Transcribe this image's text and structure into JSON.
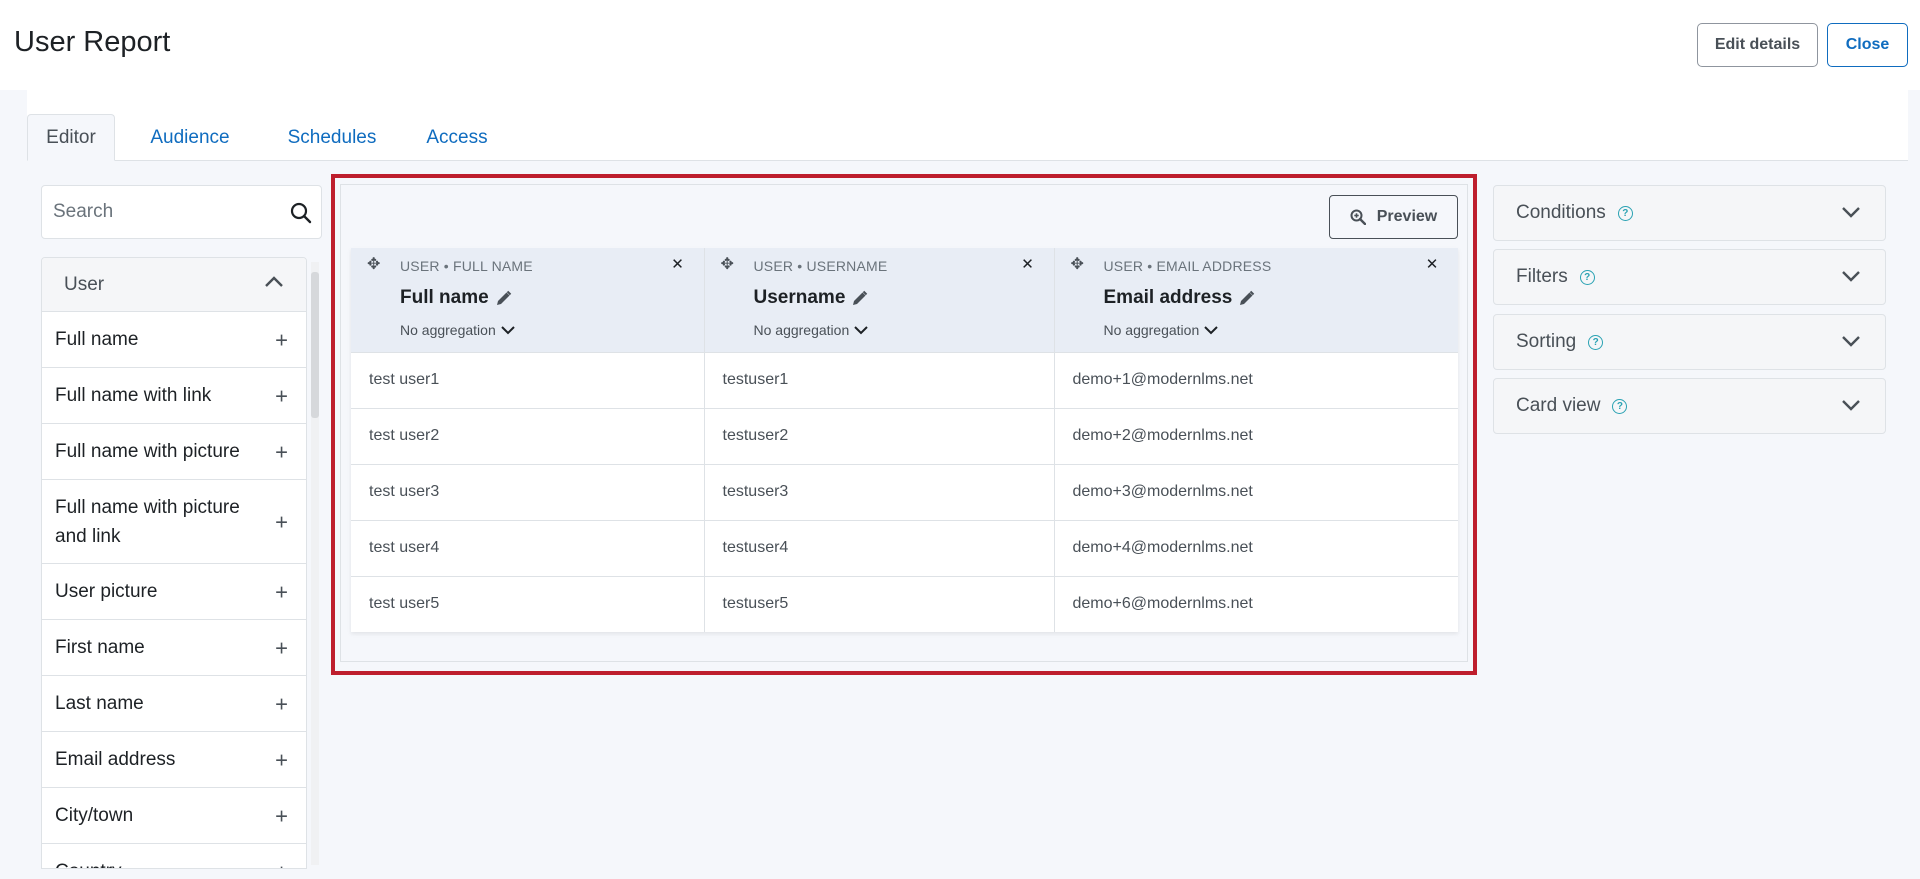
{
  "header": {
    "title": "User Report",
    "edit_label": "Edit details",
    "close_label": "Close"
  },
  "tabs": [
    {
      "label": "Editor",
      "active": true
    },
    {
      "label": "Audience"
    },
    {
      "label": "Schedules"
    },
    {
      "label": "Access"
    }
  ],
  "search": {
    "placeholder": "Search"
  },
  "sidebar": {
    "group": "User",
    "items": [
      "Full name",
      "Full name with link",
      "Full name with picture",
      "Full name with picture and link",
      "User picture",
      "First name",
      "Last name",
      "Email address",
      "City/town",
      "Country"
    ]
  },
  "preview_label": "Preview",
  "table": {
    "columns": [
      {
        "source": "USER • FULL NAME",
        "title": "Full name",
        "aggregation": "No aggregation"
      },
      {
        "source": "USER • USERNAME",
        "title": "Username",
        "aggregation": "No aggregation"
      },
      {
        "source": "USER • EMAIL ADDRESS",
        "title": "Email address",
        "aggregation": "No aggregation"
      }
    ],
    "rows": [
      [
        "test user1",
        "testuser1",
        "demo+1@modernlms.net"
      ],
      [
        "test user2",
        "testuser2",
        "demo+2@modernlms.net"
      ],
      [
        "test user3",
        "testuser3",
        "demo+3@modernlms.net"
      ],
      [
        "test user4",
        "testuser4",
        "demo+4@modernlms.net"
      ],
      [
        "test user5",
        "testuser5",
        "demo+6@modernlms.net"
      ]
    ]
  },
  "settings": [
    "Conditions",
    "Filters",
    "Sorting",
    "Card view"
  ],
  "colors": {
    "accent": "#0f6cbf",
    "highlight": "#be1e2d",
    "help": "#2aa2b3"
  }
}
